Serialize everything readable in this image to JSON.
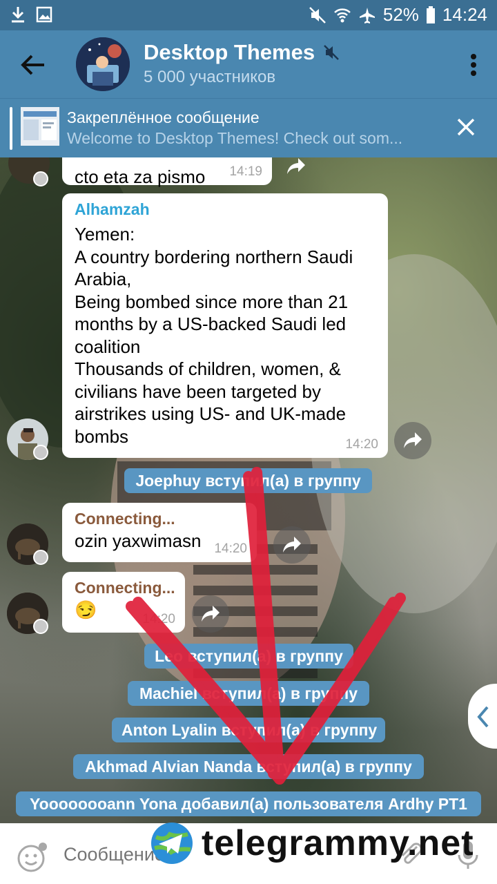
{
  "status_bar": {
    "battery": "52%",
    "time": "14:24"
  },
  "header": {
    "title": "Desktop Themes",
    "subtitle": "5 000 участников"
  },
  "pinned": {
    "title": "Закреплённое сообщение",
    "text": "Welcome to Desktop Themes!  Check out som..."
  },
  "messages": [
    {
      "text": "cto eta za pismo",
      "time": "14:19"
    },
    {
      "sender": "Alhamzah",
      "sender_color": "#2ea4d6",
      "text": "Yemen:\nA country bordering northern Saudi Arabia,\nBeing bombed since more than 21 months by a US-backed Saudi led coalition\nThousands of children, women, & civilians have been targeted by airstrikes using US- and UK-made bombs",
      "time": "14:20"
    },
    {
      "sender": "Connecting...",
      "sender_color": "#8a5a3c",
      "text": "ozin yaxwimasn",
      "time": "14:20"
    },
    {
      "sender": "Connecting...",
      "sender_color": "#8a5a3c",
      "text": "😏",
      "time": "14:20"
    }
  ],
  "service_messages": [
    "Joephuy вступил(а) в группу",
    "Leo вступил(а) в группу",
    "Machiel вступил(а) в группу",
    "Anton Lyalin вступил(а) в группу",
    "Akhmad Alvian Nanda вступил(а) в группу",
    "Yoooooooann Yona добавил(а) пользователя Ardhy PT1"
  ],
  "input": {
    "placeholder": "Сообщение"
  },
  "watermark": {
    "text": "telegrammy.net"
  },
  "colors": {
    "header": "#4a87b0",
    "status": "#3b6f93",
    "service": "#5996c2",
    "arrow": "#e0203a"
  }
}
